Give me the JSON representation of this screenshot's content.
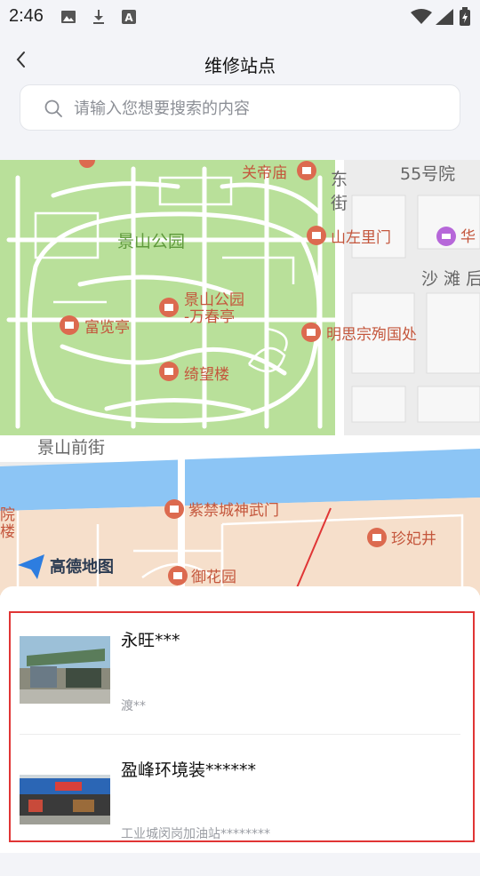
{
  "status_bar": {
    "time": "2:46",
    "icons": [
      "image-icon",
      "download-icon",
      "font-a-icon",
      "wifi-icon",
      "battery-charging-icon"
    ]
  },
  "header": {
    "title": "维修站点"
  },
  "search": {
    "placeholder": "请输入您想要搜索的内容",
    "value": ""
  },
  "map": {
    "provider": "高德地图",
    "labels": {
      "park": "景山公园",
      "guandi": "关帝庙",
      "shanzuo": "山左里门",
      "fulan": "富览亭",
      "wanchun_1": "景山公园",
      "wanchun_2": "-万春亭",
      "mingsi": "明思宗殉国处",
      "qiwang": "绮望楼",
      "jingshan_front": "景山前街",
      "shenwu": "紫禁城神武门",
      "zhenfei": "珍妃井",
      "yuhua": "御花园",
      "no55": "55号院",
      "dong": "东",
      "jie": "街",
      "shatan": "沙 滩 后",
      "hua": "华",
      "yuan": "院",
      "lou": "楼"
    }
  },
  "stations": [
    {
      "name": "永旺***",
      "address": "渡**"
    },
    {
      "name": "盈峰环境装******",
      "address": "工业城闵岗加油站********"
    }
  ],
  "colors": {
    "accent_red": "#e03535",
    "poi": "#c4563c",
    "park_green": "#b9e09a",
    "water": "#8cc5f5"
  }
}
